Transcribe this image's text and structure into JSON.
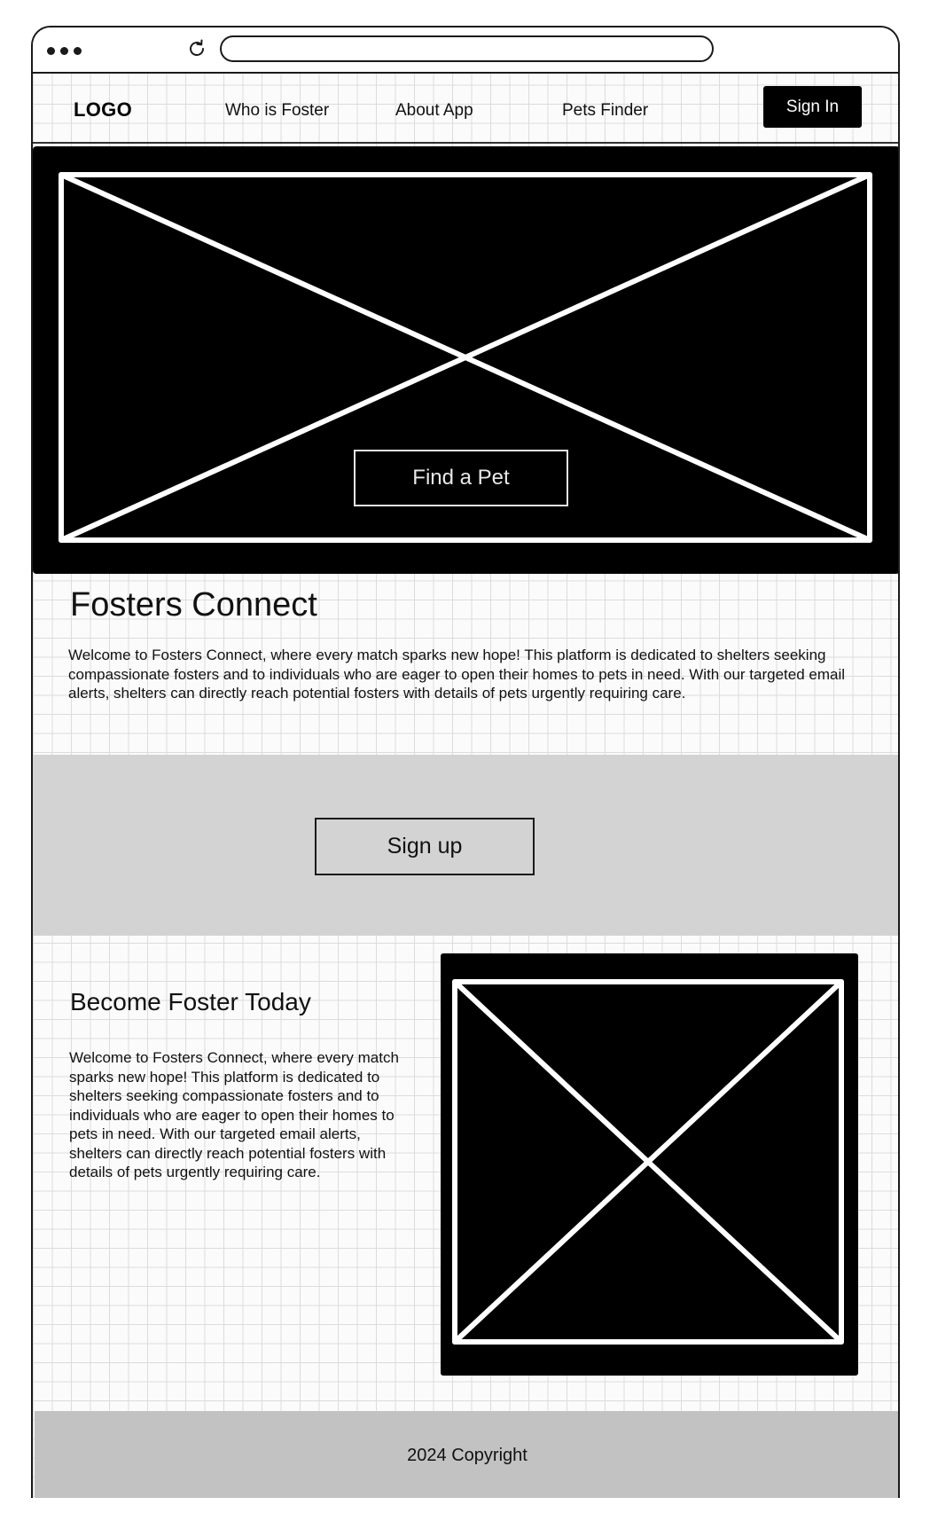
{
  "nav": {
    "logo": "LOGO",
    "links": [
      {
        "label": "Who is Foster"
      },
      {
        "label": "About App"
      },
      {
        "label": "Pets Finder"
      }
    ],
    "signin_label": "Sign In"
  },
  "hero": {
    "cta_label": "Find a Pet"
  },
  "intro": {
    "title": "Fosters Connect",
    "text": "Welcome to Fosters Connect, where every match sparks new hope! This platform is dedicated to shelters seeking compassionate fosters and to individuals who are eager to open their homes to pets in need. With our targeted email alerts, shelters can directly reach potential fosters with details of pets urgently requiring care."
  },
  "signup": {
    "button_label": "Sign up"
  },
  "become": {
    "title": "Become Foster Today",
    "text": "Welcome to Fosters Connect, where every match sparks new hope! This platform is dedicated to shelters seeking compassionate fosters and to individuals who are eager to open their homes to pets in need. With our targeted email alerts, shelters can directly reach potential fosters with details of pets urgently requiring care."
  },
  "footer": {
    "copyright": "2024 Copyright"
  },
  "icons": {
    "window_controls": "dots-icon",
    "reload": "reload-icon",
    "image_placeholder": "image-placeholder-icon"
  }
}
